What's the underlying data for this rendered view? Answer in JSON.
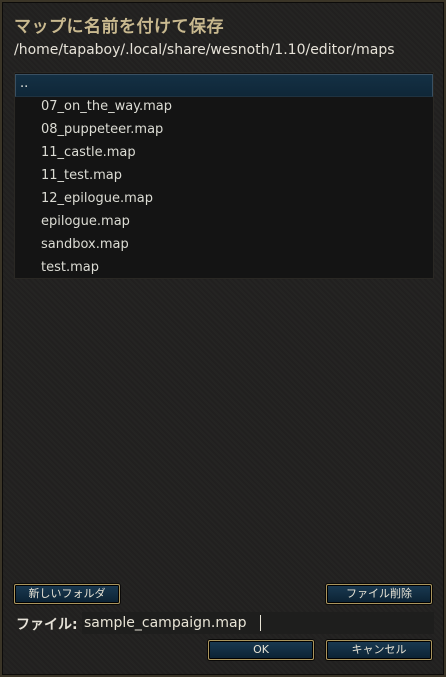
{
  "dialog": {
    "title": "マップに名前を付けて保存",
    "path": "/home/tapaboy/.local/share/wesnoth/1.10/editor/maps"
  },
  "file_list": {
    "items": [
      "..",
      "07_on_the_way.map",
      "08_puppeteer.map",
      "11_castle.map",
      "11_test.map",
      "12_epilogue.map",
      "epilogue.map",
      "sandbox.map",
      "test.map"
    ],
    "selected": ".."
  },
  "buttons": {
    "new_folder": "新しいフォルダ",
    "delete_file": "ファイル削除",
    "ok": "OK",
    "cancel": "キャンセル"
  },
  "filename": {
    "label": "ファイル:",
    "value": "sample_campaign.map"
  },
  "colors": {
    "title": "#c9b98f",
    "button_border": "#aa955d",
    "button_fill": "#0b2233",
    "selection": "#143044"
  }
}
